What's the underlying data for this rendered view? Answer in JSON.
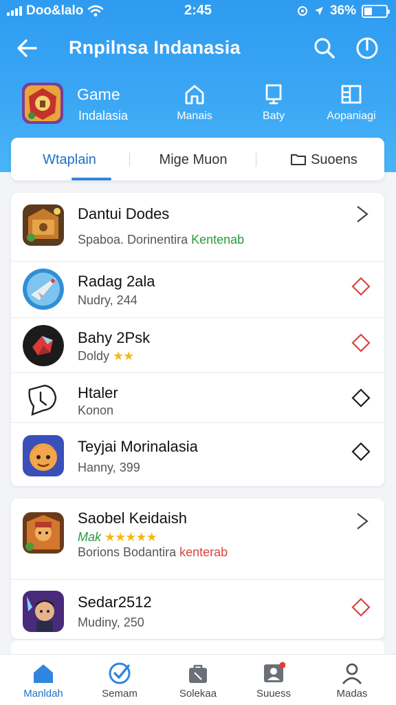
{
  "status_bar": {
    "carrier": "Doo&lalo",
    "time": "2:45",
    "battery_text": "36%",
    "battery_level": 0.36
  },
  "header": {
    "title": "Rnpilnsa Indanasia",
    "game_label": "Game",
    "game_sub": "Indalasia",
    "categories": [
      {
        "label": "Manais",
        "icon": "home-outline-icon"
      },
      {
        "label": "Baty",
        "icon": "monitor-icon"
      },
      {
        "label": "Aopaniagi",
        "icon": "grid-icon"
      }
    ]
  },
  "tabs": [
    {
      "label": "Wtaplain",
      "active": true
    },
    {
      "label": "Mige Muon",
      "active": false
    },
    {
      "label": "Suoens",
      "active": false
    }
  ],
  "list1": [
    {
      "title": "Dantui Dodes",
      "sub_plain": "Spaboa. Dorinentira",
      "sub_accent": "Kentenab",
      "accent": "green",
      "chevron": "open"
    },
    {
      "title": "Radag 2ala",
      "sub_plain": "Nudry, 244",
      "chevron": "diamond-red"
    },
    {
      "title": "Bahy 2Psk",
      "sub_plain": "Doldy",
      "stars": "★★",
      "chevron": "diamond-red"
    },
    {
      "title": "Htaler",
      "sub_plain": "Konon",
      "chevron": "diamond-dark"
    },
    {
      "title": "Teyjai Morinalasia",
      "sub_plain": "Hanny, 399",
      "chevron": "diamond-dark"
    }
  ],
  "list2": [
    {
      "title": "Saobel Keidaish",
      "sub_green": "Mak",
      "stars": "★★★★★",
      "sub_plain": "Borions Bodantira",
      "sub_accent": "kenterab",
      "accent": "red",
      "chevron": "open"
    },
    {
      "title": "Sedar2512",
      "sub_plain": "Mudiny, 250",
      "chevron": "diamond-red"
    }
  ],
  "bottom_nav": [
    {
      "label": "Manldah",
      "icon": "home-icon",
      "active": true
    },
    {
      "label": "Semam",
      "icon": "check-circle-icon",
      "active": false
    },
    {
      "label": "Solekaa",
      "icon": "bag-icon",
      "active": false
    },
    {
      "label": "Suuess",
      "icon": "profile-card-icon",
      "active": false,
      "badge": true
    },
    {
      "label": "Madas",
      "icon": "person-icon",
      "active": false
    }
  ],
  "colors": {
    "header_top": "#2f9bf0",
    "accent_blue": "#1f6fc4",
    "chevron_red": "#d9443c",
    "green": "#2a9a3c",
    "star": "#f5b81a"
  }
}
